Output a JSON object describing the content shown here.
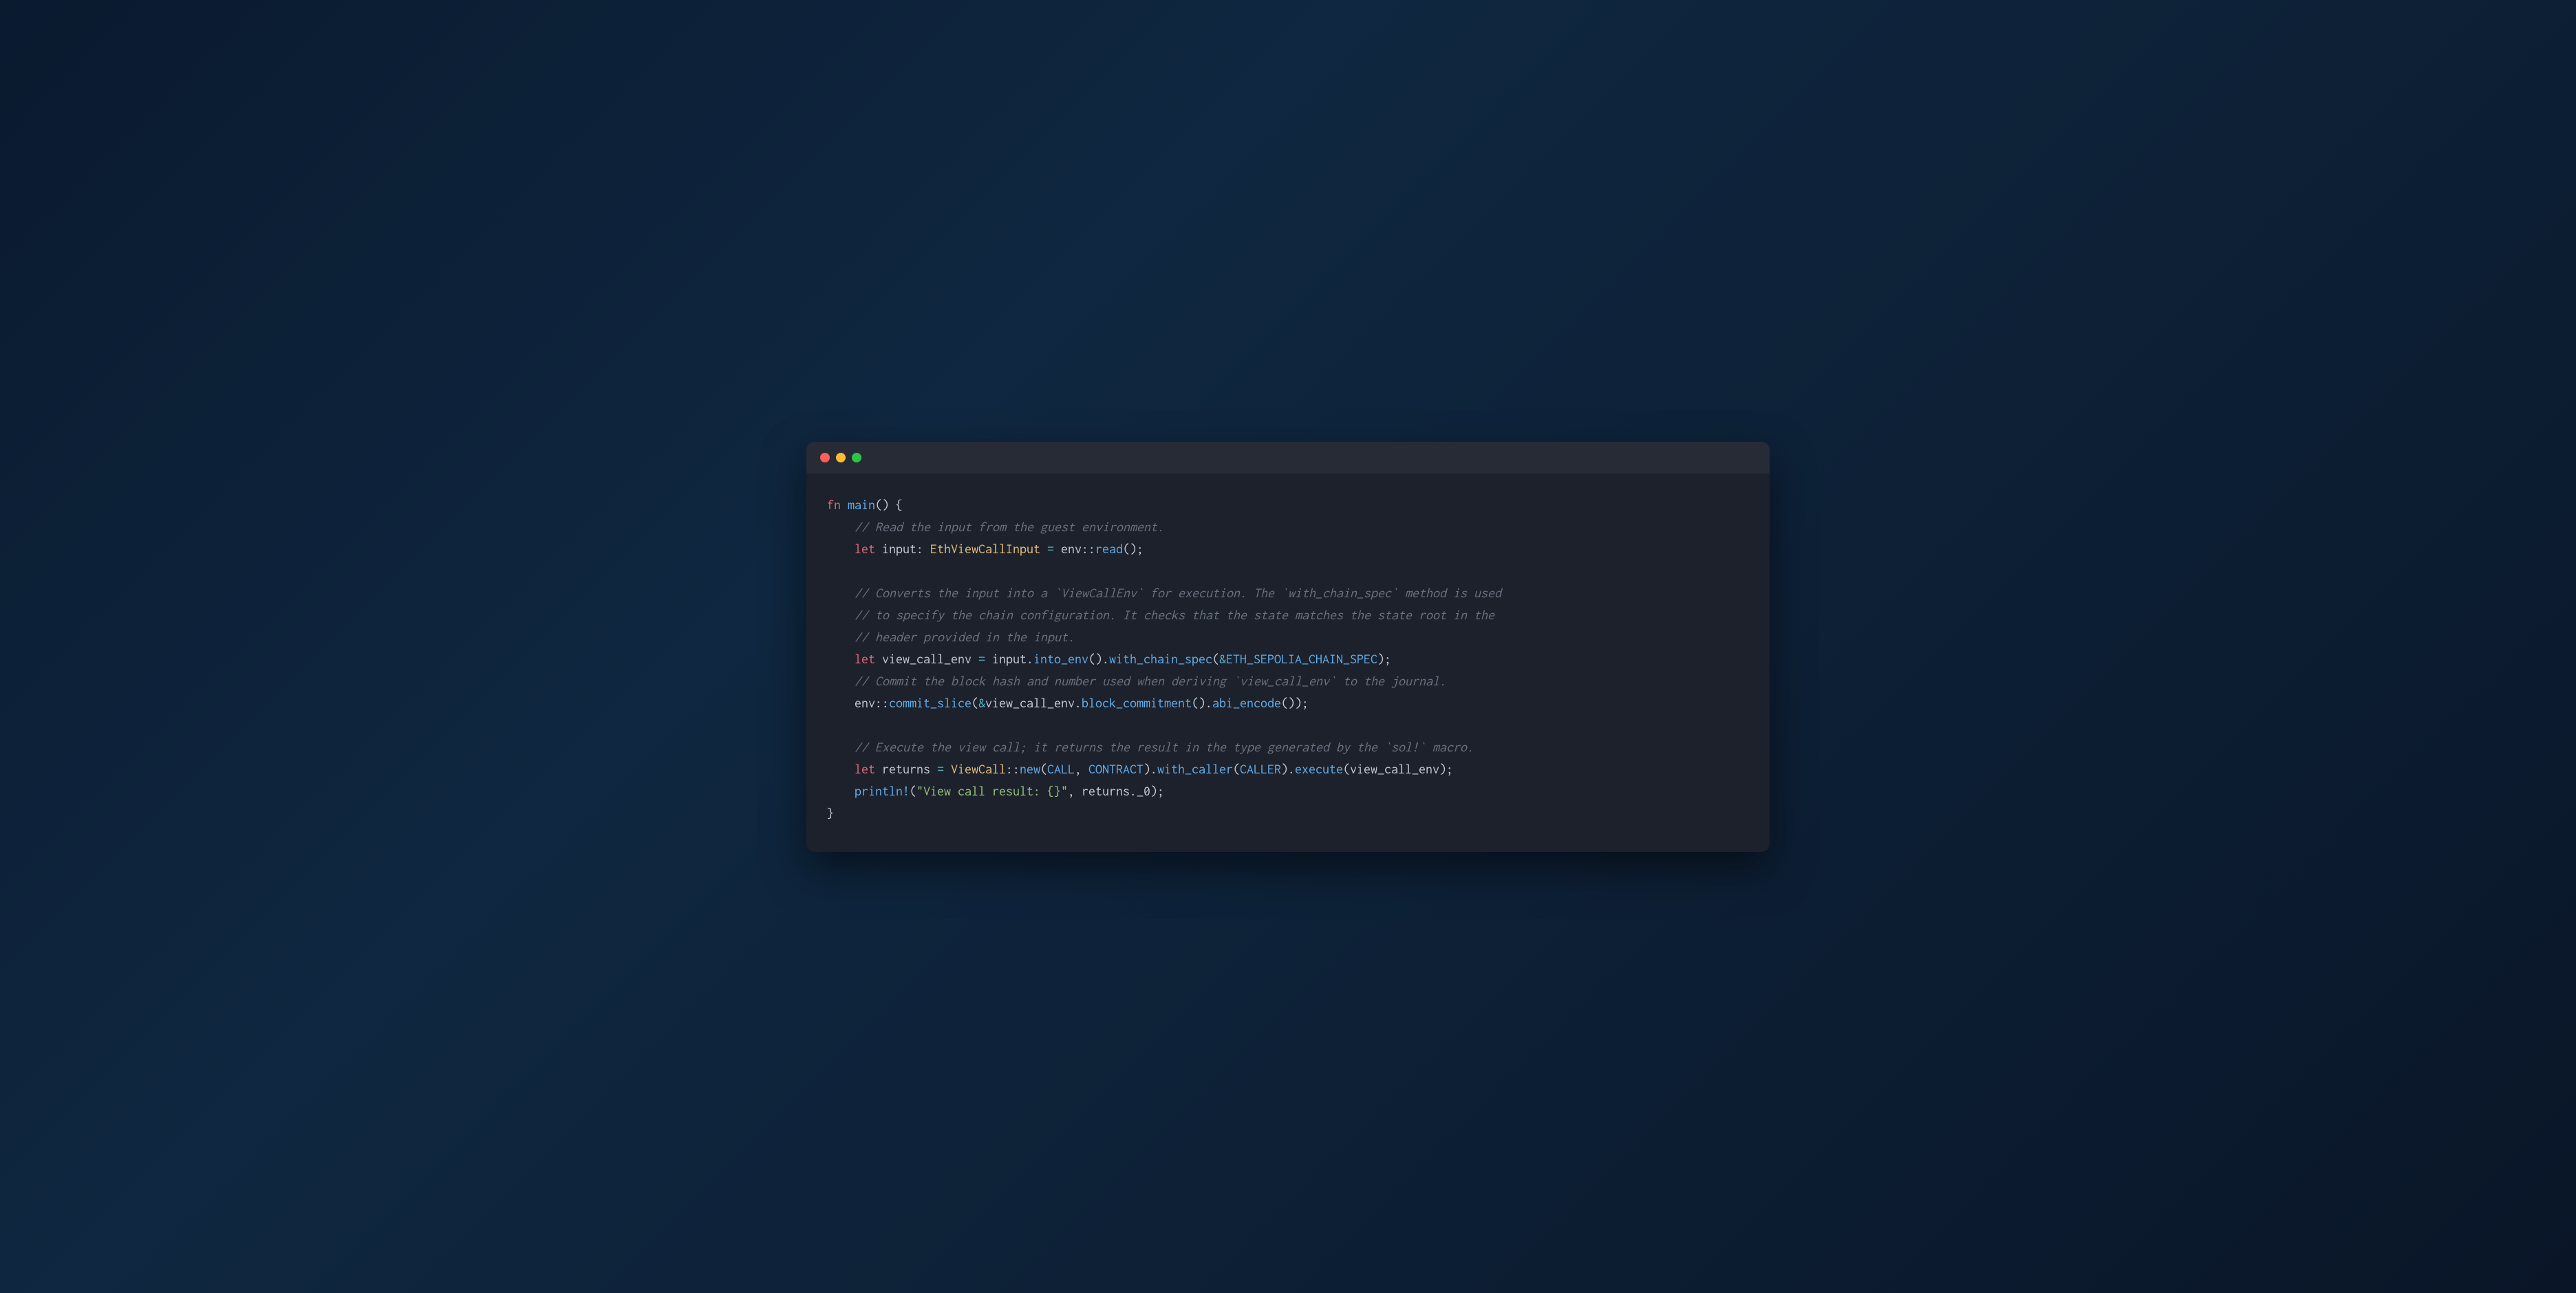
{
  "window": {
    "dots": [
      "red",
      "yellow",
      "green"
    ]
  },
  "code": {
    "l1": {
      "fn": "fn",
      "name": "main",
      "parens": "()",
      "brace_open": " {"
    },
    "l2": {
      "comment": "    // Read the input from the guest environment."
    },
    "l3": {
      "indent": "    ",
      "let": "let",
      "var": " input",
      "colon": ": ",
      "type": "EthViewCallInput",
      "eq": " = ",
      "ns": "env",
      "sep": "::",
      "method": "read",
      "tail": "();"
    },
    "l4": {
      "comment": "    // Converts the input into a `ViewCallEnv` for execution. The `with_chain_spec` method is used"
    },
    "l5": {
      "comment": "    // to specify the chain configuration. It checks that the state matches the state root in the"
    },
    "l6": {
      "comment": "    // header provided in the input."
    },
    "l7": {
      "indent": "    ",
      "let": "let",
      "var": " view_call_env ",
      "eq": "=",
      "sp": " input",
      "dot1": ".",
      "m1": "into_env",
      "p1": "()",
      "dot2": ".",
      "m2": "with_chain_spec",
      "open": "(",
      "amp": "&",
      "const": "ETH_SEPOLIA_CHAIN_SPEC",
      "close": ");"
    },
    "l8": {
      "comment": "    // Commit the block hash and number used when deriving `view_call_env` to the journal."
    },
    "l9": {
      "indent": "    ",
      "ns": "env",
      "sep": "::",
      "m1": "commit_slice",
      "open": "(",
      "amp": "&",
      "var": "view_call_env",
      "dot1": ".",
      "m2": "block_commitment",
      "p2": "()",
      "dot2": ".",
      "m3": "abi_encode",
      "p3": "()",
      "close": ");"
    },
    "l10": {
      "comment": "    // Execute the view call; it returns the result in the type generated by the `sol!` macro."
    },
    "l11": {
      "indent": "    ",
      "let": "let",
      "var": " returns ",
      "eq": "=",
      "sp": " ",
      "type": "ViewCall",
      "sep": "::",
      "m1": "new",
      "open": "(",
      "c1": "CALL",
      "comma": ", ",
      "c2": "CONTRACT",
      "close1": ")",
      "dot1": ".",
      "m2": "with_caller",
      "open2": "(",
      "c3": "CALLER",
      "close2": ")",
      "dot2": ".",
      "m3": "execute",
      "open3": "(",
      "arg": "view_call_env",
      "close3": ");"
    },
    "l12": {
      "indent": "    ",
      "macro": "println!",
      "open": "(",
      "str": "\"View call result: {}\"",
      "comma": ", ",
      "var": "returns",
      "dot": ".",
      "field": "_0",
      "close": ");"
    },
    "l13": {
      "brace_close": "}"
    }
  }
}
